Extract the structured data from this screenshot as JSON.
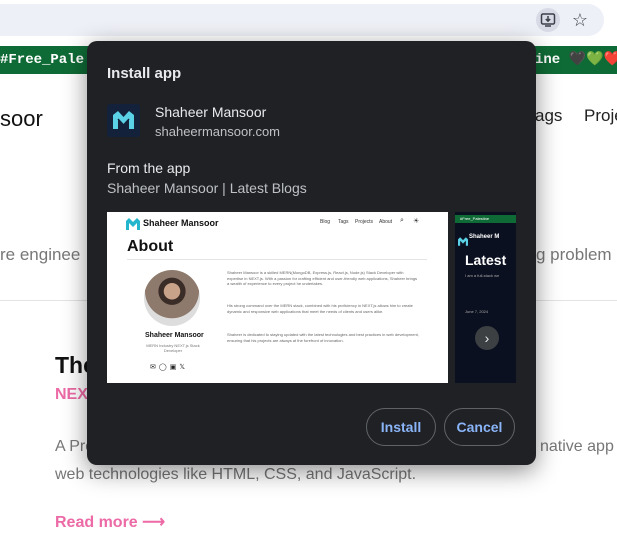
{
  "browser": {
    "install_icon": "install-app-icon",
    "star_icon": "bookmark-star-icon"
  },
  "banner": {
    "left_text": "#Free_Pale",
    "right_text": "ine 🖤💚❤️"
  },
  "page": {
    "logo_text": "soor",
    "nav_tags": "ags",
    "nav_projects": "Proje",
    "hero_left": "re enginee",
    "hero_right": "g problem",
    "post_title": "The",
    "post_tag": "NEX",
    "post_desc_line1": "A Pro",
    "post_desc_line1_right": "native app",
    "post_desc_line2": "web technologies like HTML, CSS, and JavaScript.",
    "read_more": "Read more ⟶"
  },
  "dialog": {
    "title": "Install app",
    "app_name": "Shaheer Mansoor",
    "app_url": "shaheermansoor.com",
    "from_label": "From the app",
    "from_value": "Shaheer Mansoor | Latest Blogs",
    "install_button": "Install",
    "cancel_button": "Cancel",
    "screenshot1": {
      "brand": "Shaheer Mansoor",
      "nav": [
        "Blog",
        "Tags",
        "Projects",
        "About"
      ],
      "heading": "About",
      "name": "Shaheer Mansoor",
      "role": "MERN Industry NEXT.js Stack Developer",
      "para1": "Shaheer Mansoor is a skilled MERN(MongoDB, Express.js, React.js, Node.js) Stack Developer with expertise in NEXT.js. With a passion for crafting efficient and user-friendly web applications, Shaheer brings a wealth of experience to every project he undertakes.",
      "para2": "His strong command over the MERN stack, combined with his proficiency in NEXT.js allows him to create dynamic and responsive web applications that meet the needs of clients and users alike.",
      "para3": "Shaheer is dedicated to staying updated with the latest technologies and best practices in web development, ensuring that his projects are always at the forefront of innovation."
    },
    "screenshot2": {
      "banner": "#Free_Palestine",
      "brand": "Shaheer M",
      "title": "Latest",
      "subtitle": "I am a full-stack we",
      "date": "June 7, 2024"
    }
  }
}
